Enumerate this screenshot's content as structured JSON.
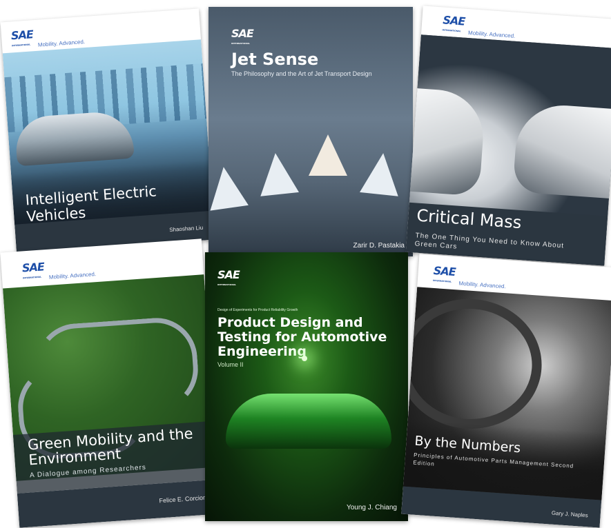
{
  "publisher": {
    "logo_text": "SAE",
    "logo_sub": "INTERNATIONAL",
    "tagline": "Mobility. Advanced."
  },
  "books": [
    {
      "title": "Intelligent Electric Vehicles",
      "author": "Shaoshan Liu"
    },
    {
      "title": "Jet Sense",
      "subtitle": "The Philosophy and the Art of Jet Transport Design",
      "author": "Zarir D. Pastakia"
    },
    {
      "title": "Critical Mass",
      "subtitle": "The One Thing You Need to Know About Green Cars"
    },
    {
      "title": "Green Mobility and the Environment",
      "subtitle": "A Dialogue among Researchers",
      "author": "Felice E. Corcione"
    },
    {
      "series": "Design of Experiments for Product Reliability Growth",
      "title": "Product Design and Testing for Automotive Engineering",
      "volume": "Volume II",
      "author": "Young J. Chiang"
    },
    {
      "title": "By the Numbers",
      "subtitle": "Principles of Automotive Parts Management Second Edition",
      "author": "Gary J. Naples"
    }
  ]
}
